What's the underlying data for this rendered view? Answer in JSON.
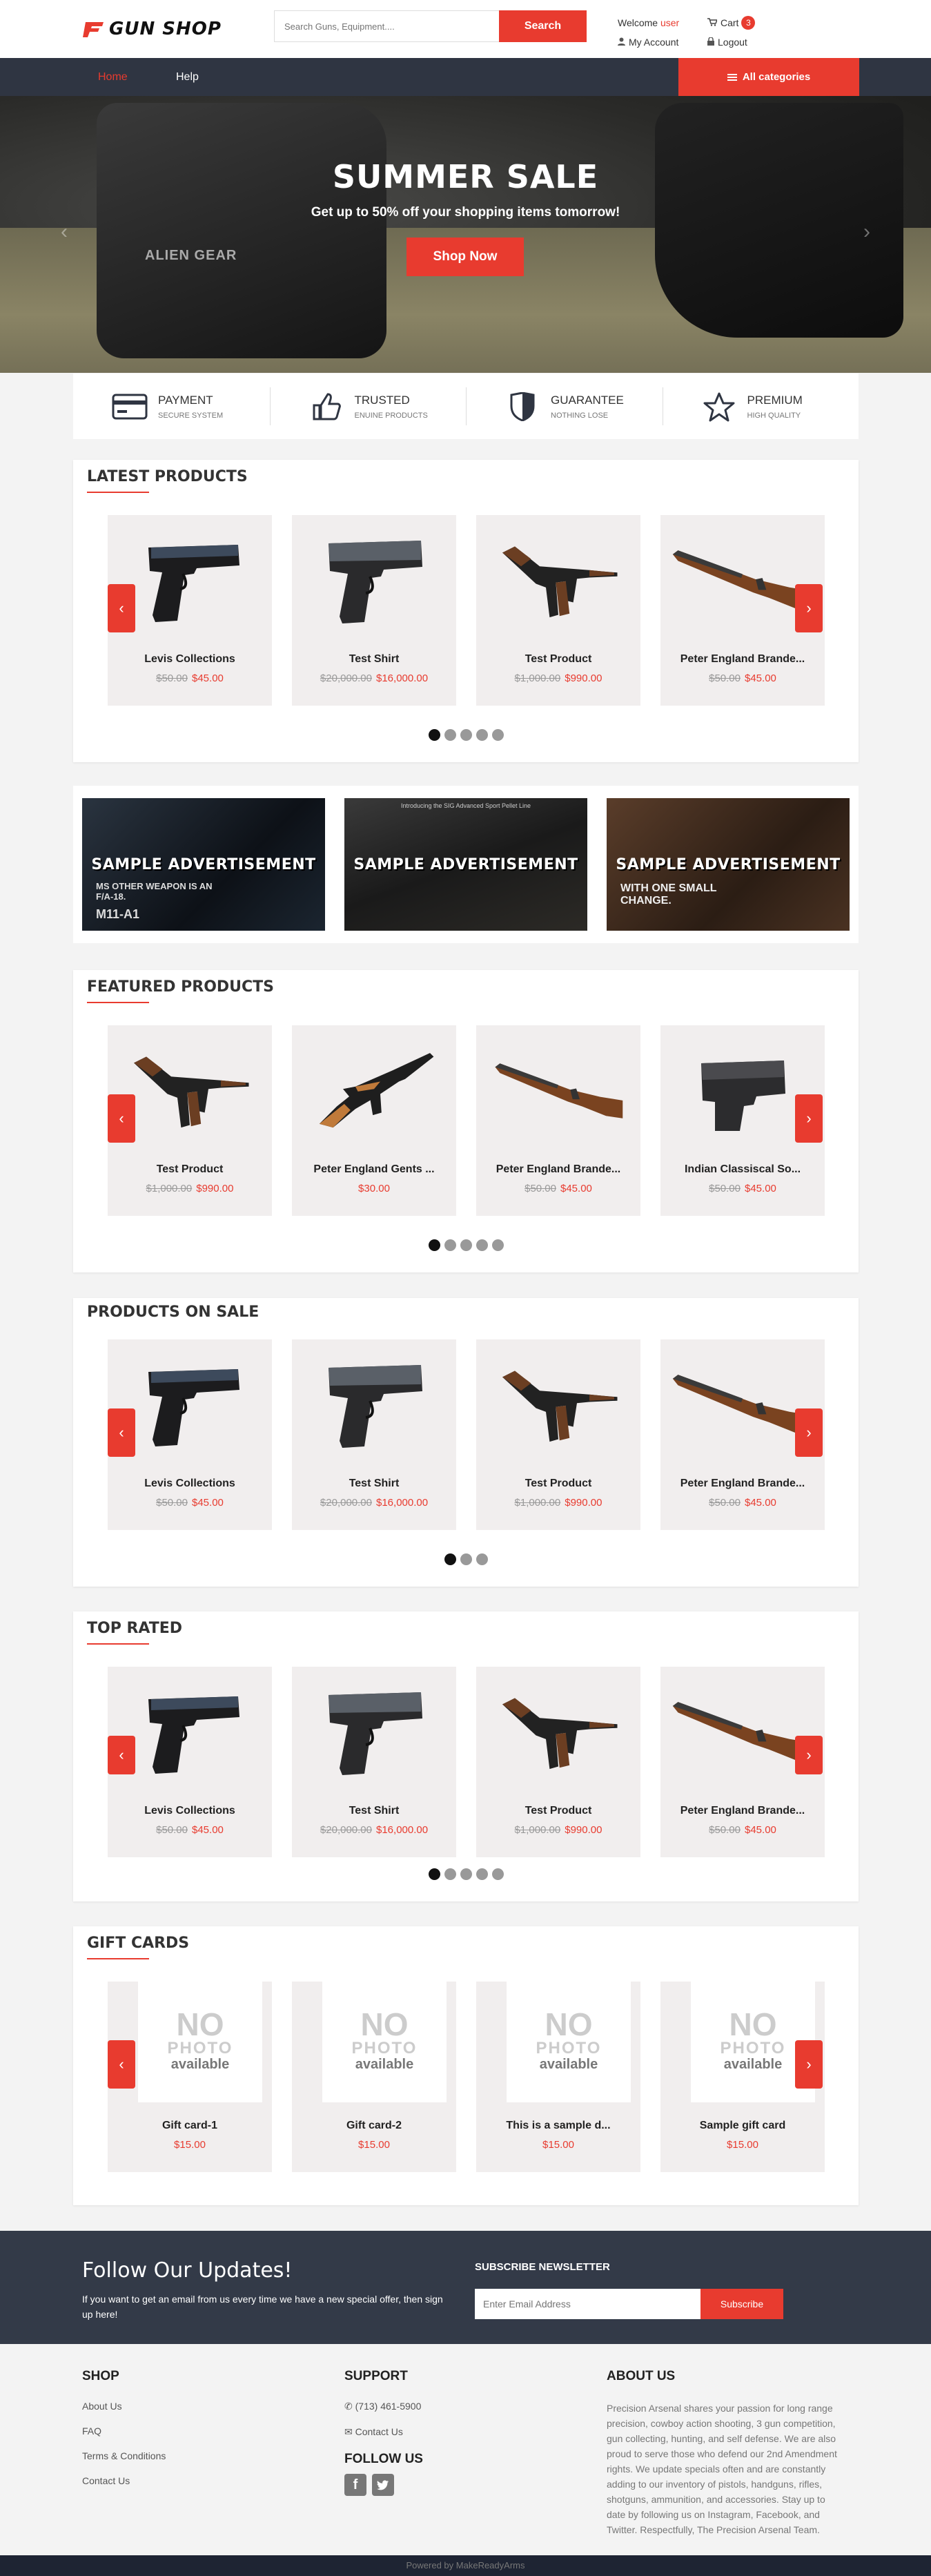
{
  "header": {
    "logo_text": "GUN SHOP",
    "search_placeholder": "Search Guns, Equipment....",
    "search_button": "Search",
    "welcome_prefix": "Welcome",
    "welcome_user": "user",
    "cart_label": "Cart",
    "cart_count": "3",
    "my_account": "My Account",
    "logout": "Logout"
  },
  "nav": {
    "home": "Home",
    "help": "Help",
    "all_categories": "All categories"
  },
  "hero": {
    "title": "SUMMER SALE",
    "subtitle": "Get up to 50% off your shopping items tomorrow!",
    "button": "Shop Now",
    "watermark": "ALIEN GEAR"
  },
  "features": [
    {
      "title": "PAYMENT",
      "sub": "SECURE SYSTEM",
      "icon": "credit-card-icon"
    },
    {
      "title": "TRUSTED",
      "sub": "ENUINE PRODUCTS",
      "icon": "thumbs-up-icon"
    },
    {
      "title": "GUARANTEE",
      "sub": "NOTHING LOSE",
      "icon": "shield-icon"
    },
    {
      "title": "PREMIUM",
      "sub": "HIGH QUALITY",
      "icon": "star-icon"
    }
  ],
  "latest": {
    "title": "LATEST PRODUCTS",
    "items": [
      {
        "name": "Levis Collections",
        "old": "$50.00",
        "price": "$45.00"
      },
      {
        "name": "Test Shirt",
        "old": "$20,000.00",
        "price": "$16,000.00"
      },
      {
        "name": "Test Product",
        "old": "$1,000.00",
        "price": "$990.00"
      },
      {
        "name": "Peter England Brande...",
        "old": "$50.00",
        "price": "$45.00"
      }
    ]
  },
  "ads": [
    {
      "text": "SAMPLE ADVERTISEMENT",
      "tagline": "MS OTHER WEAPON IS AN F/A-18.",
      "model": "M11-A1"
    },
    {
      "text": "SAMPLE ADVERTISEMENT",
      "tagline": "Introducing the SIG Advanced Sport Pellet Line"
    },
    {
      "text": "SAMPLE ADVERTISEMENT",
      "tagline": "WITH ONE SMALL CHANGE."
    }
  ],
  "featured": {
    "title": "FEATURED PRODUCTS",
    "items": [
      {
        "name": "Test Product",
        "old": "$1,000.00",
        "price": "$990.00"
      },
      {
        "name": "Peter England Gents ...",
        "old": "",
        "price": "$30.00"
      },
      {
        "name": "Peter England Brande...",
        "old": "$50.00",
        "price": "$45.00"
      },
      {
        "name": "Indian Classiscal So...",
        "old": "$50.00",
        "price": "$45.00"
      }
    ]
  },
  "onsale": {
    "title": "PRODUCTS ON SALE",
    "items": [
      {
        "name": "Levis Collections",
        "old": "$50.00",
        "price": "$45.00"
      },
      {
        "name": "Test Shirt",
        "old": "$20,000.00",
        "price": "$16,000.00"
      },
      {
        "name": "Test Product",
        "old": "$1,000.00",
        "price": "$990.00"
      },
      {
        "name": "Peter England Brande...",
        "old": "$50.00",
        "price": "$45.00"
      }
    ]
  },
  "toprated": {
    "title": "TOP RATED",
    "items": [
      {
        "name": "Levis Collections",
        "old": "$50.00",
        "price": "$45.00"
      },
      {
        "name": "Test Shirt",
        "old": "$20,000.00",
        "price": "$16,000.00"
      },
      {
        "name": "Test Product",
        "old": "$1,000.00",
        "price": "$990.00"
      },
      {
        "name": "Peter England Brande...",
        "old": "$50.00",
        "price": "$45.00"
      }
    ]
  },
  "giftcards": {
    "title": "GIFT CARDS",
    "no_photo_1": "NO",
    "no_photo_2": "PHOTO",
    "no_photo_3": "available",
    "items": [
      {
        "name": "Gift card-1",
        "price": "$15.00"
      },
      {
        "name": "Gift card-2",
        "price": "$15.00"
      },
      {
        "name": "This is a sample d...",
        "price": "$15.00"
      },
      {
        "name": "Sample gift card",
        "price": "$15.00"
      }
    ]
  },
  "newsletter": {
    "title": "Follow Our Updates!",
    "desc": "If you want to get an email from us every time we have a new special offer, then sign up here!",
    "subhead": "SUBSCRIBE NEWSLETTER",
    "placeholder": "Enter Email Address",
    "button": "Subscribe"
  },
  "footer": {
    "shop_title": "SHOP",
    "shop_links": [
      "About Us",
      "FAQ",
      "Terms & Conditions",
      "Contact Us"
    ],
    "support_title": "SUPPORT",
    "phone": "(713) 461-5900",
    "contact": "Contact Us",
    "follow_title": "FOLLOW US",
    "about_title": "ABOUT US",
    "about_text": "Precision Arsenal shares your passion for long range precision, cowboy action shooting, 3 gun competition, gun collecting, hunting, and self defense. We are also proud to serve those who defend our 2nd Amendment rights. We update specials often and are constantly adding to our inventory of pistols, handguns, rifles, shotguns, ammunition, and accessories. Stay up to date by following us on Instagram, Facebook, and Twitter. Respectfully, The Precision Arsenal Team.",
    "powered": "Powered by MakeReadyArms"
  },
  "colors": {
    "accent": "#e83b2f",
    "nav_bg": "#2f3542",
    "news_bg": "#333a48"
  }
}
